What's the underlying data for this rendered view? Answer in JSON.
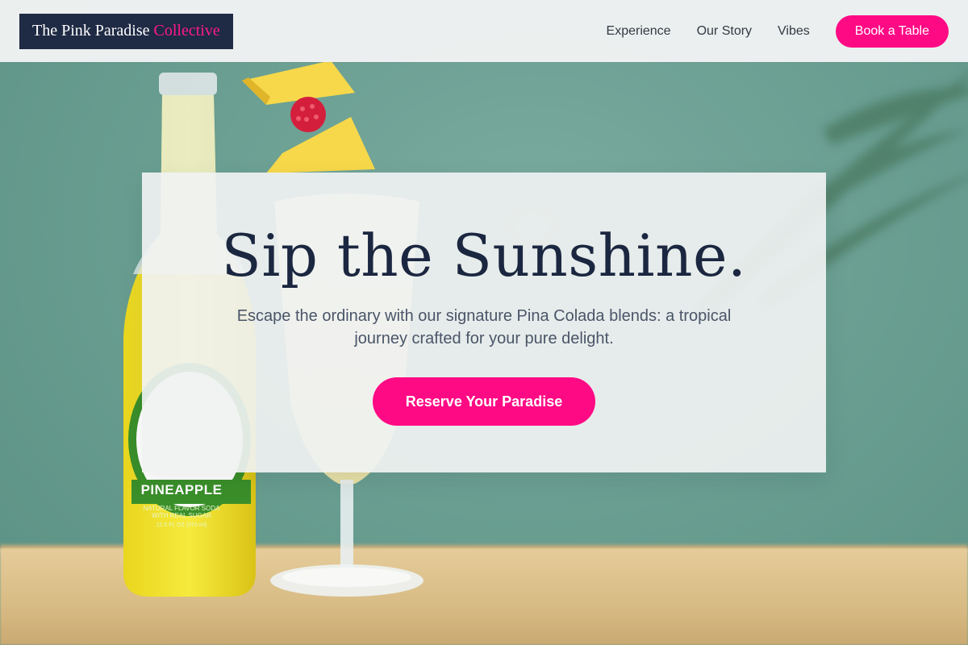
{
  "brand": {
    "name_main": "The Pink Paradise",
    "name_accent": "Collective"
  },
  "nav": {
    "items": [
      {
        "label": "Experience"
      },
      {
        "label": "Our Story"
      },
      {
        "label": "Vibes"
      }
    ],
    "cta_label": "Book a Table"
  },
  "hero": {
    "title": "Sip the Sunshine.",
    "subtitle": "Escape the ordinary with our signature Pina Colada blends: a tropical journey crafted for your pure delight.",
    "cta_label": "Reserve Your Paradise"
  },
  "background_image": {
    "bottle_label_title": "PINEAPPLE",
    "bottle_label_line1": "NATURAL FLAVOR SODA",
    "bottle_label_line2": "WITH REAL SUGAR",
    "bottle_label_line3": "12.5 FL OZ (370 ml)"
  },
  "colors": {
    "accent": "#ff0a85",
    "logo_bg": "#1f2a44",
    "heading": "#1b2640",
    "backdrop": "#6a9e92"
  }
}
